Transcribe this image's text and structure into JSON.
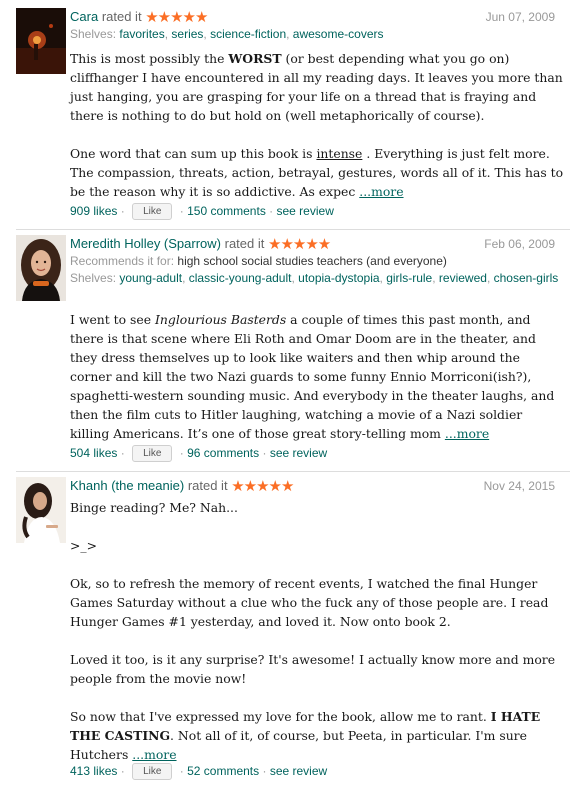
{
  "reviews": [
    {
      "reviewer": "Cara",
      "rated_text": "rated it",
      "stars": "★★★★★",
      "date": "Jun 07, 2009",
      "shelves_label": "Shelves:",
      "shelves": [
        "favorites",
        "series",
        "science-fiction",
        "awesome-covers"
      ],
      "body": {
        "p1_a": "This is most possibly the ",
        "p1_bold": "WORST",
        "p1_b": " (or best depending what you go on) cliffhanger I have encountered in all my reading days. It leaves you more than just hanging, you are grasping for your life on a thread that is fraying and there is nothing to do but hold on (well metaphorically of course).",
        "p2_a": "One word that can sum up this book is ",
        "p2_u": "intense",
        "p2_b": " . Everything is just felt more. The compassion, threats, action, betrayal, gestures, words all of it. This has to be the reason why it is so addictive. As expec ",
        "more": "...more"
      },
      "likes": "909 likes",
      "like_button": "Like",
      "comments": "150 comments",
      "see_review": "see review"
    },
    {
      "reviewer": "Meredith Holley (Sparrow)",
      "rated_text": "rated it",
      "stars": "★★★★★",
      "date": "Feb 06, 2009",
      "recommends_label": "Recommends it for:",
      "recommends": "high school social studies teachers (and everyone)",
      "shelves_label": "Shelves:",
      "shelves": [
        "young-adult",
        "classic-young-adult",
        "utopia-dystopia",
        "girls-rule",
        "reviewed",
        "chosen-girls"
      ],
      "body": {
        "p1_a": "I went to see ",
        "p1_italic": "Inglourious Basterds",
        "p1_b": " a couple of times this past month, and there is that scene where Eli Roth and Omar Doom are in the theater, and they dress themselves up to look like waiters and then whip around the corner and kill the two Nazi guards to some funny Ennio Morriconi(ish?), spaghetti-western sounding music. And everybody in the theater laughs, and then the film cuts to Hitler laughing, watching a movie of a Nazi soldier killing Americans. It’s one of those great story-telling mom ",
        "more": "...more"
      },
      "likes": "504 likes",
      "like_button": "Like",
      "comments": "96 comments",
      "see_review": "see review"
    },
    {
      "reviewer": "Khanh (the meanie)",
      "rated_text": "rated it",
      "stars": "★★★★★",
      "date": "Nov 24, 2015",
      "body": {
        "p1": "Binge reading? Me? Nah...",
        "p2": ">_>",
        "p3": "Ok, so to refresh the memory of recent events, I watched the final Hunger Games Saturday without a clue who the fuck any of those people are. I read Hunger Games #1 yesterday, and loved it. Now onto book 2.",
        "p4": "Loved it too, is it any surprise? It's awesome! I actually know more and more people from the movie now!",
        "p5_a": "So now that I've expressed my love for the book, allow me to rant. ",
        "p5_bold": "I HATE THE CASTING",
        "p5_b": ". Not all of it, of course, but Peeta, in particular. I'm sure Hutchers ",
        "more": "...more"
      },
      "likes": "413 likes",
      "like_button": "Like",
      "comments": "52 comments",
      "see_review": "see review"
    }
  ],
  "colors": {
    "link": "#00635d",
    "star": "#fb6e25",
    "muted": "#999999"
  }
}
